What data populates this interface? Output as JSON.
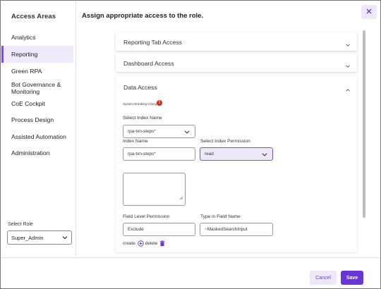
{
  "sidebar": {
    "title": "Access Areas",
    "items": [
      {
        "label": "Analytics",
        "active": false
      },
      {
        "label": "Reporting",
        "active": true
      },
      {
        "label": "Green RPA",
        "active": false
      },
      {
        "label": "Bot Governance & Monitoring",
        "active": false
      },
      {
        "label": "CoE Cockpit",
        "active": false
      },
      {
        "label": "Process Design",
        "active": false
      },
      {
        "label": "Assisted Automation",
        "active": false
      },
      {
        "label": "Administration",
        "active": false
      }
    ],
    "select_role_label": "Select Role",
    "selected_role": "Super_Admin"
  },
  "header": {
    "title": "Assign appropriate access to the role."
  },
  "accordions": {
    "reporting_tab": "Reporting Tab Access",
    "dashboard": "Dashboard Access",
    "data_access": "Data Access"
  },
  "data_access": {
    "system_breaking_label": "System Breaking Changes",
    "warning_glyph": "!",
    "select_index_name_label": "Select Index Name",
    "select_index_name_value": "rpa-txn-steps*",
    "index_name_label": "Index Name",
    "index_name_value": "rpa-txn-steps*",
    "select_index_permission_label": "Select Index Permission",
    "select_index_permission_value": "read",
    "field_level_permission_label": "Field Level Permission",
    "field_level_permission_value": "Exclude",
    "type_in_field_name_label": "Type in Field Name",
    "type_in_field_name_value": "~MaskedSearchInput",
    "create_label": "create",
    "delete_label": "delete"
  },
  "footer": {
    "cancel_label": "Cancel",
    "save_label": "Save"
  },
  "colors": {
    "accent": "#6a35d6",
    "accent_light": "#efe8fb",
    "warning": "#d9261c"
  },
  "icons": [
    "close-icon",
    "chevron-down-icon",
    "chevron-up-icon",
    "warning-icon",
    "add-circle-icon",
    "trash-icon"
  ]
}
